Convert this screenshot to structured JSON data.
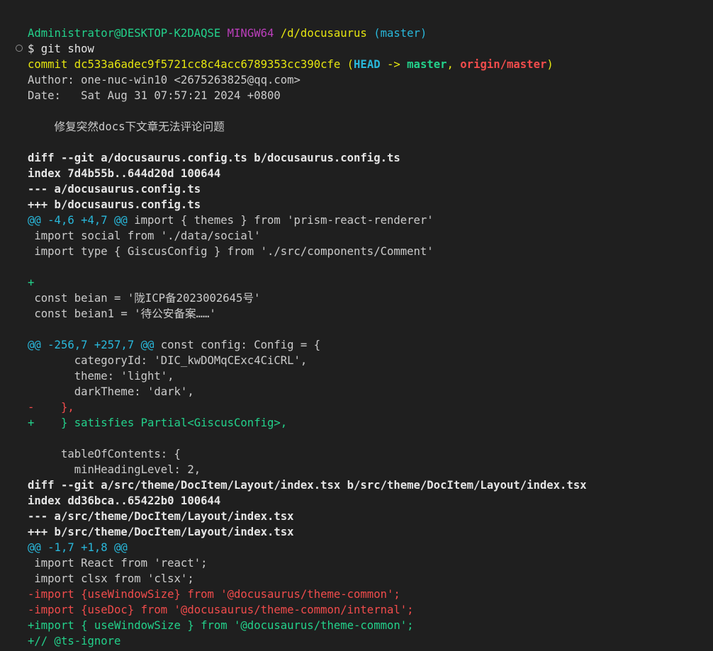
{
  "prompt": {
    "user_host": "Administrator@DESKTOP-K2DAQSE",
    "shell": "MINGW64",
    "path": "/d/docusaurus",
    "branch": "(master)"
  },
  "command": "$ git show",
  "commit": {
    "label": "commit",
    "hash": "dc533a6adec9f5721cc8c4acc6789353cc390cfe",
    "ref_open": "(",
    "head": "HEAD",
    "arrow": " -> ",
    "master": "master",
    "comma": ", ",
    "origin": "origin/master",
    "ref_close": ")",
    "author": "Author: one-nuc-win10 <2675263825@qq.com>",
    "date": "Date:   Sat Aug 31 07:57:21 2024 +0800",
    "message": "    修复突然docs下文章无法评论问题"
  },
  "diff1": {
    "header": "diff --git a/docusaurus.config.ts b/docusaurus.config.ts",
    "index": "index 7d4b55b..644d20d 100644",
    "minus_file": "--- a/docusaurus.config.ts",
    "plus_file": "+++ b/docusaurus.config.ts",
    "hunk1_range": "@@ -4,6 +4,7 @@",
    "hunk1_ctx": " import { themes } from 'prism-react-renderer'",
    "l1": " import social from './data/social'",
    "l2": " import type { GiscusConfig } from './src/components/Comment'",
    "l3": " ",
    "l4": "+",
    "l5": " const beian = '陇ICP备2023002645号'",
    "l6": " const beian1 = '待公安备案……'",
    "l7": " ",
    "hunk2_range": "@@ -256,7 +257,7 @@",
    "hunk2_ctx": " const config: Config = {",
    "l8": "       categoryId: 'DIC_kwDOMqCExc4CiCRL',",
    "l9": "       theme: 'light',",
    "l10": "       darkTheme: 'dark',",
    "l11": "-    },",
    "l12": "+    } satisfies Partial<GiscusConfig>,",
    "l13": " ",
    "l14": "     tableOfContents: {",
    "l15": "       minHeadingLevel: 2,"
  },
  "diff2": {
    "header": "diff --git a/src/theme/DocItem/Layout/index.tsx b/src/theme/DocItem/Layout/index.tsx",
    "index": "index dd36bca..65422b0 100644",
    "minus_file": "--- a/src/theme/DocItem/Layout/index.tsx",
    "plus_file": "+++ b/src/theme/DocItem/Layout/index.tsx",
    "hunk1_range": "@@ -1,7 +1,8 @@",
    "l1": " import React from 'react';",
    "l2": " import clsx from 'clsx';",
    "l3": "-import {useWindowSize} from '@docusaurus/theme-common';",
    "l4": "-import {useDoc} from '@docusaurus/theme-common/internal';",
    "l5": "+import { useWindowSize } from '@docusaurus/theme-common';",
    "l6": "+// @ts-ignore"
  },
  "colors": {
    "background": "#1f1f1f",
    "green": "#23d18b",
    "magenta": "#bc3fbc",
    "yellow": "#e5e510",
    "cyan": "#29b8db",
    "red": "#f14c4c"
  },
  "icons": {
    "command_marker": "circle-outline-icon"
  }
}
